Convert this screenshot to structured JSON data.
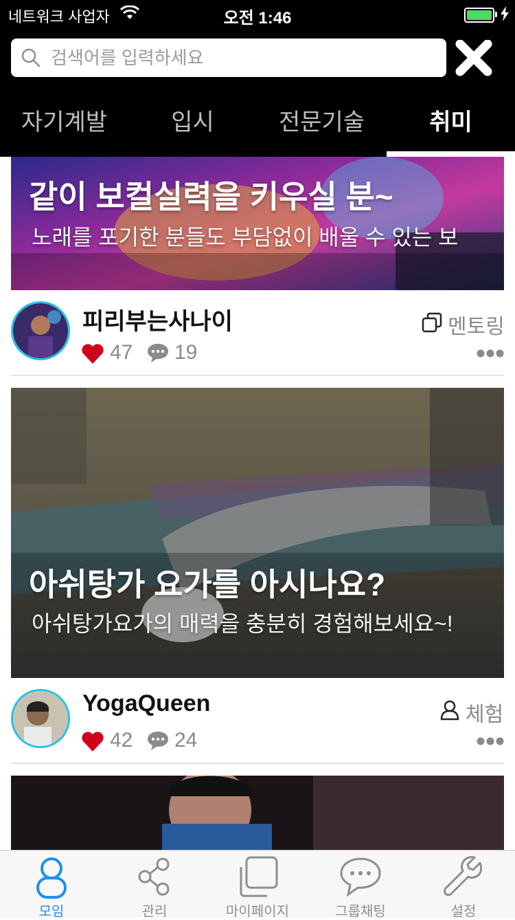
{
  "status_bar": {
    "carrier": "네트워크 사업자",
    "time": "오전 1:46",
    "battery_level": 1.0,
    "battery_color": "#4cd964"
  },
  "search": {
    "placeholder": "검색어를 입력하세요",
    "value": ""
  },
  "tabs": [
    {
      "label": "자기계발",
      "active": false
    },
    {
      "label": "입시",
      "active": false
    },
    {
      "label": "전문기술",
      "active": false
    },
    {
      "label": "취미",
      "active": true
    }
  ],
  "feed": [
    {
      "title": "같이 보컬실력을 키우실 분~",
      "subtitle": "노래를 포기한 분들도 부담없이 배울 수 있는 보",
      "author": "피리부는사나이",
      "likes": "47",
      "comments": "19",
      "type_label": "멘토링",
      "type_icon": "copy-icon"
    },
    {
      "title": "아쉬탕가 요가를 아시나요?",
      "subtitle": "아쉬탕가요가의 매력을 충분히 경험해보세요~!",
      "author": "YogaQueen",
      "likes": "42",
      "comments": "24",
      "type_label": "체험",
      "type_icon": "person-icon"
    }
  ],
  "bottom_nav": [
    {
      "label": "모임",
      "icon": "group-icon",
      "active": true
    },
    {
      "label": "관리",
      "icon": "share-icon",
      "active": false
    },
    {
      "label": "마이페이지",
      "icon": "page-icon",
      "active": false
    },
    {
      "label": "그룹채팅",
      "icon": "chat-icon",
      "active": false
    },
    {
      "label": "설정",
      "icon": "wrench-icon",
      "active": false
    }
  ],
  "colors": {
    "accent": "#1f8ff0",
    "heart": "#d0021b",
    "avatar_ring": "#27c1e6"
  }
}
